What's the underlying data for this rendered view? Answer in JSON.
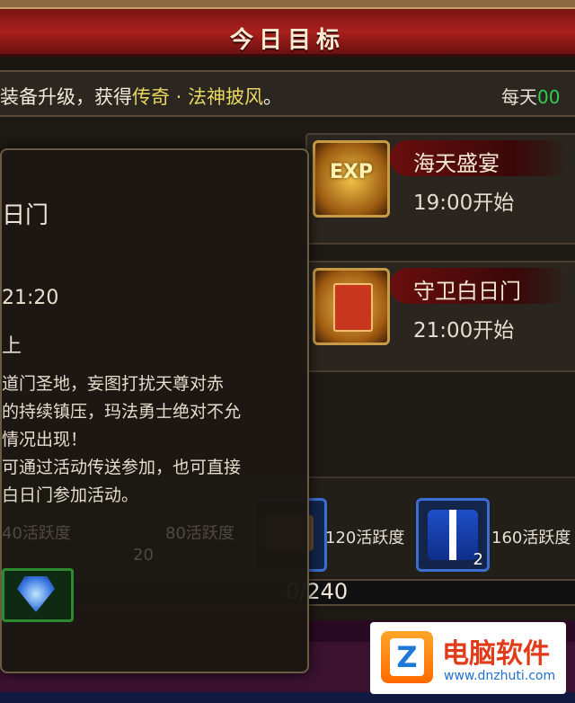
{
  "header": {
    "title": "今日目标"
  },
  "notice": {
    "prefix": "装备升级，获得",
    "highlight": "传奇 · 法神披风",
    "suffix": "。",
    "daily_label": "每天",
    "daily_value": "00"
  },
  "events": [
    {
      "name": "海天盛宴",
      "time": "19:00开始",
      "icon": "exp-scroll-icon",
      "icon_text": "EXP"
    },
    {
      "name": "守卫白日门",
      "time": "21:00开始",
      "icon": "red-book-icon",
      "icon_text": ""
    }
  ],
  "tooltip": {
    "title": "日门",
    "time": "21:20",
    "level": "上",
    "description": [
      "道门圣地，妄图打扰天尊对赤",
      "的持续镇压，玛法勇士绝对不允",
      "情况出现！",
      "可通过活动传送参加，也可直接",
      "白日门参加活动。"
    ],
    "faded_items": [
      "40活跃度",
      "80活跃度",
      "20"
    ]
  },
  "rewards": [
    {
      "label": "120活跃度"
    },
    {
      "label": "160活跃度",
      "count": "2"
    }
  ],
  "progress": {
    "text": "0/240",
    "value": 0,
    "max": 240
  },
  "watermark": {
    "name": "电脑软件",
    "url": "www.dnzhuti.com",
    "mark": "Z"
  },
  "colors": {
    "title_bar": "#a8201c",
    "highlight": "#e9d860",
    "daily_green": "#2fd04b",
    "reward_border": "#3b6ed0",
    "gem_border": "#2e8a2e"
  }
}
